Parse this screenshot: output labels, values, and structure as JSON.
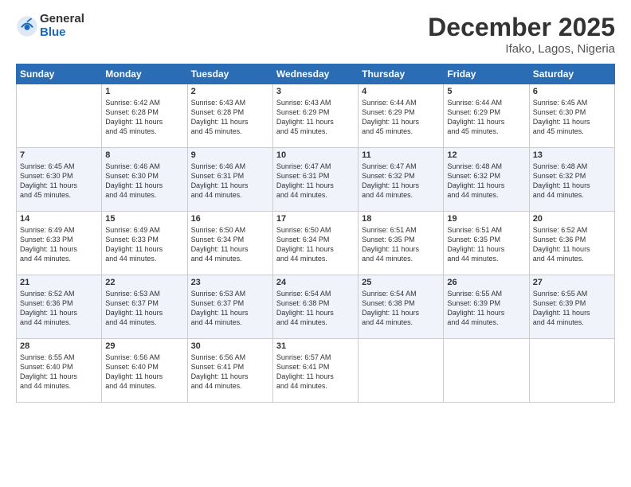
{
  "logo": {
    "general": "General",
    "blue": "Blue"
  },
  "header": {
    "month_year": "December 2025",
    "location": "Ifako, Lagos, Nigeria"
  },
  "weekdays": [
    "Sunday",
    "Monday",
    "Tuesday",
    "Wednesday",
    "Thursday",
    "Friday",
    "Saturday"
  ],
  "weeks": [
    [
      {
        "day": "",
        "info": ""
      },
      {
        "day": "1",
        "info": "Sunrise: 6:42 AM\nSunset: 6:28 PM\nDaylight: 11 hours\nand 45 minutes."
      },
      {
        "day": "2",
        "info": "Sunrise: 6:43 AM\nSunset: 6:28 PM\nDaylight: 11 hours\nand 45 minutes."
      },
      {
        "day": "3",
        "info": "Sunrise: 6:43 AM\nSunset: 6:29 PM\nDaylight: 11 hours\nand 45 minutes."
      },
      {
        "day": "4",
        "info": "Sunrise: 6:44 AM\nSunset: 6:29 PM\nDaylight: 11 hours\nand 45 minutes."
      },
      {
        "day": "5",
        "info": "Sunrise: 6:44 AM\nSunset: 6:29 PM\nDaylight: 11 hours\nand 45 minutes."
      },
      {
        "day": "6",
        "info": "Sunrise: 6:45 AM\nSunset: 6:30 PM\nDaylight: 11 hours\nand 45 minutes."
      }
    ],
    [
      {
        "day": "7",
        "info": "Sunrise: 6:45 AM\nSunset: 6:30 PM\nDaylight: 11 hours\nand 45 minutes."
      },
      {
        "day": "8",
        "info": "Sunrise: 6:46 AM\nSunset: 6:30 PM\nDaylight: 11 hours\nand 44 minutes."
      },
      {
        "day": "9",
        "info": "Sunrise: 6:46 AM\nSunset: 6:31 PM\nDaylight: 11 hours\nand 44 minutes."
      },
      {
        "day": "10",
        "info": "Sunrise: 6:47 AM\nSunset: 6:31 PM\nDaylight: 11 hours\nand 44 minutes."
      },
      {
        "day": "11",
        "info": "Sunrise: 6:47 AM\nSunset: 6:32 PM\nDaylight: 11 hours\nand 44 minutes."
      },
      {
        "day": "12",
        "info": "Sunrise: 6:48 AM\nSunset: 6:32 PM\nDaylight: 11 hours\nand 44 minutes."
      },
      {
        "day": "13",
        "info": "Sunrise: 6:48 AM\nSunset: 6:32 PM\nDaylight: 11 hours\nand 44 minutes."
      }
    ],
    [
      {
        "day": "14",
        "info": "Sunrise: 6:49 AM\nSunset: 6:33 PM\nDaylight: 11 hours\nand 44 minutes."
      },
      {
        "day": "15",
        "info": "Sunrise: 6:49 AM\nSunset: 6:33 PM\nDaylight: 11 hours\nand 44 minutes."
      },
      {
        "day": "16",
        "info": "Sunrise: 6:50 AM\nSunset: 6:34 PM\nDaylight: 11 hours\nand 44 minutes."
      },
      {
        "day": "17",
        "info": "Sunrise: 6:50 AM\nSunset: 6:34 PM\nDaylight: 11 hours\nand 44 minutes."
      },
      {
        "day": "18",
        "info": "Sunrise: 6:51 AM\nSunset: 6:35 PM\nDaylight: 11 hours\nand 44 minutes."
      },
      {
        "day": "19",
        "info": "Sunrise: 6:51 AM\nSunset: 6:35 PM\nDaylight: 11 hours\nand 44 minutes."
      },
      {
        "day": "20",
        "info": "Sunrise: 6:52 AM\nSunset: 6:36 PM\nDaylight: 11 hours\nand 44 minutes."
      }
    ],
    [
      {
        "day": "21",
        "info": "Sunrise: 6:52 AM\nSunset: 6:36 PM\nDaylight: 11 hours\nand 44 minutes."
      },
      {
        "day": "22",
        "info": "Sunrise: 6:53 AM\nSunset: 6:37 PM\nDaylight: 11 hours\nand 44 minutes."
      },
      {
        "day": "23",
        "info": "Sunrise: 6:53 AM\nSunset: 6:37 PM\nDaylight: 11 hours\nand 44 minutes."
      },
      {
        "day": "24",
        "info": "Sunrise: 6:54 AM\nSunset: 6:38 PM\nDaylight: 11 hours\nand 44 minutes."
      },
      {
        "day": "25",
        "info": "Sunrise: 6:54 AM\nSunset: 6:38 PM\nDaylight: 11 hours\nand 44 minutes."
      },
      {
        "day": "26",
        "info": "Sunrise: 6:55 AM\nSunset: 6:39 PM\nDaylight: 11 hours\nand 44 minutes."
      },
      {
        "day": "27",
        "info": "Sunrise: 6:55 AM\nSunset: 6:39 PM\nDaylight: 11 hours\nand 44 minutes."
      }
    ],
    [
      {
        "day": "28",
        "info": "Sunrise: 6:55 AM\nSunset: 6:40 PM\nDaylight: 11 hours\nand 44 minutes."
      },
      {
        "day": "29",
        "info": "Sunrise: 6:56 AM\nSunset: 6:40 PM\nDaylight: 11 hours\nand 44 minutes."
      },
      {
        "day": "30",
        "info": "Sunrise: 6:56 AM\nSunset: 6:41 PM\nDaylight: 11 hours\nand 44 minutes."
      },
      {
        "day": "31",
        "info": "Sunrise: 6:57 AM\nSunset: 6:41 PM\nDaylight: 11 hours\nand 44 minutes."
      },
      {
        "day": "",
        "info": ""
      },
      {
        "day": "",
        "info": ""
      },
      {
        "day": "",
        "info": ""
      }
    ]
  ]
}
